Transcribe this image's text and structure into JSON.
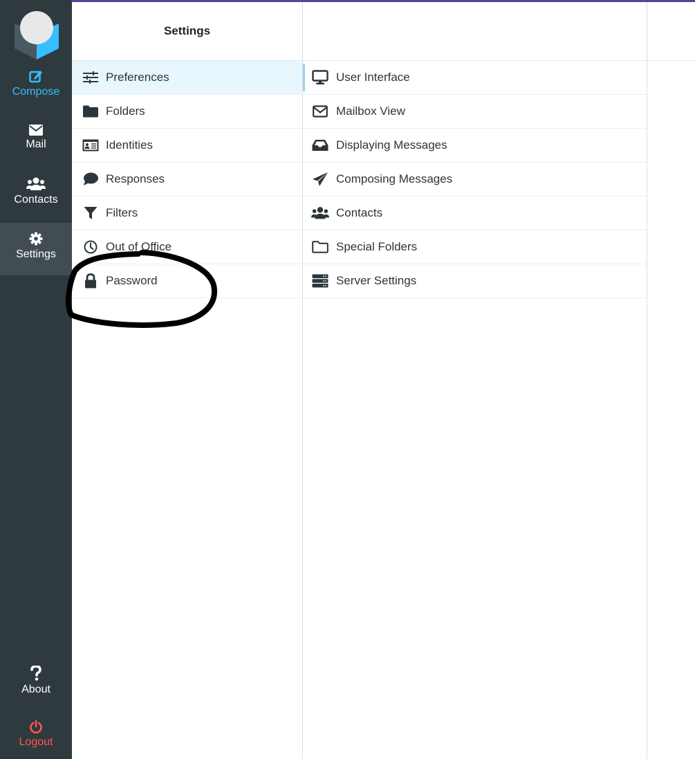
{
  "nav": {
    "compose": {
      "label": "Compose",
      "icon": "compose-icon"
    },
    "mail": {
      "label": "Mail",
      "icon": "envelope-icon"
    },
    "contacts": {
      "label": "Contacts",
      "icon": "users-icon"
    },
    "settings": {
      "label": "Settings",
      "icon": "gear-icon"
    },
    "about": {
      "label": "About",
      "icon": "question-icon"
    },
    "logout": {
      "label": "Logout",
      "icon": "power-icon"
    }
  },
  "settings": {
    "title": "Settings",
    "items": [
      {
        "label": "Preferences",
        "icon": "sliders-icon",
        "selected": true
      },
      {
        "label": "Folders",
        "icon": "folder-icon"
      },
      {
        "label": "Identities",
        "icon": "id-card-icon"
      },
      {
        "label": "Responses",
        "icon": "comment-icon"
      },
      {
        "label": "Filters",
        "icon": "filter-icon"
      },
      {
        "label": "Out of Office",
        "icon": "clock-icon"
      },
      {
        "label": "Password",
        "icon": "lock-icon"
      }
    ]
  },
  "sections": {
    "items": [
      {
        "label": "User Interface",
        "icon": "monitor-icon"
      },
      {
        "label": "Mailbox View",
        "icon": "envelope-outline-icon"
      },
      {
        "label": "Displaying Messages",
        "icon": "inbox-icon"
      },
      {
        "label": "Composing Messages",
        "icon": "paper-plane-icon"
      },
      {
        "label": "Contacts",
        "icon": "users-icon"
      },
      {
        "label": "Special Folders",
        "icon": "folder-outline-icon"
      },
      {
        "label": "Server Settings",
        "icon": "server-icon"
      }
    ]
  },
  "colors": {
    "nav_bg": "#2f3a3f",
    "accent": "#37beff",
    "logout": "#ff5552",
    "selected_row": "#e8f6fd",
    "annotation": "#000000"
  }
}
